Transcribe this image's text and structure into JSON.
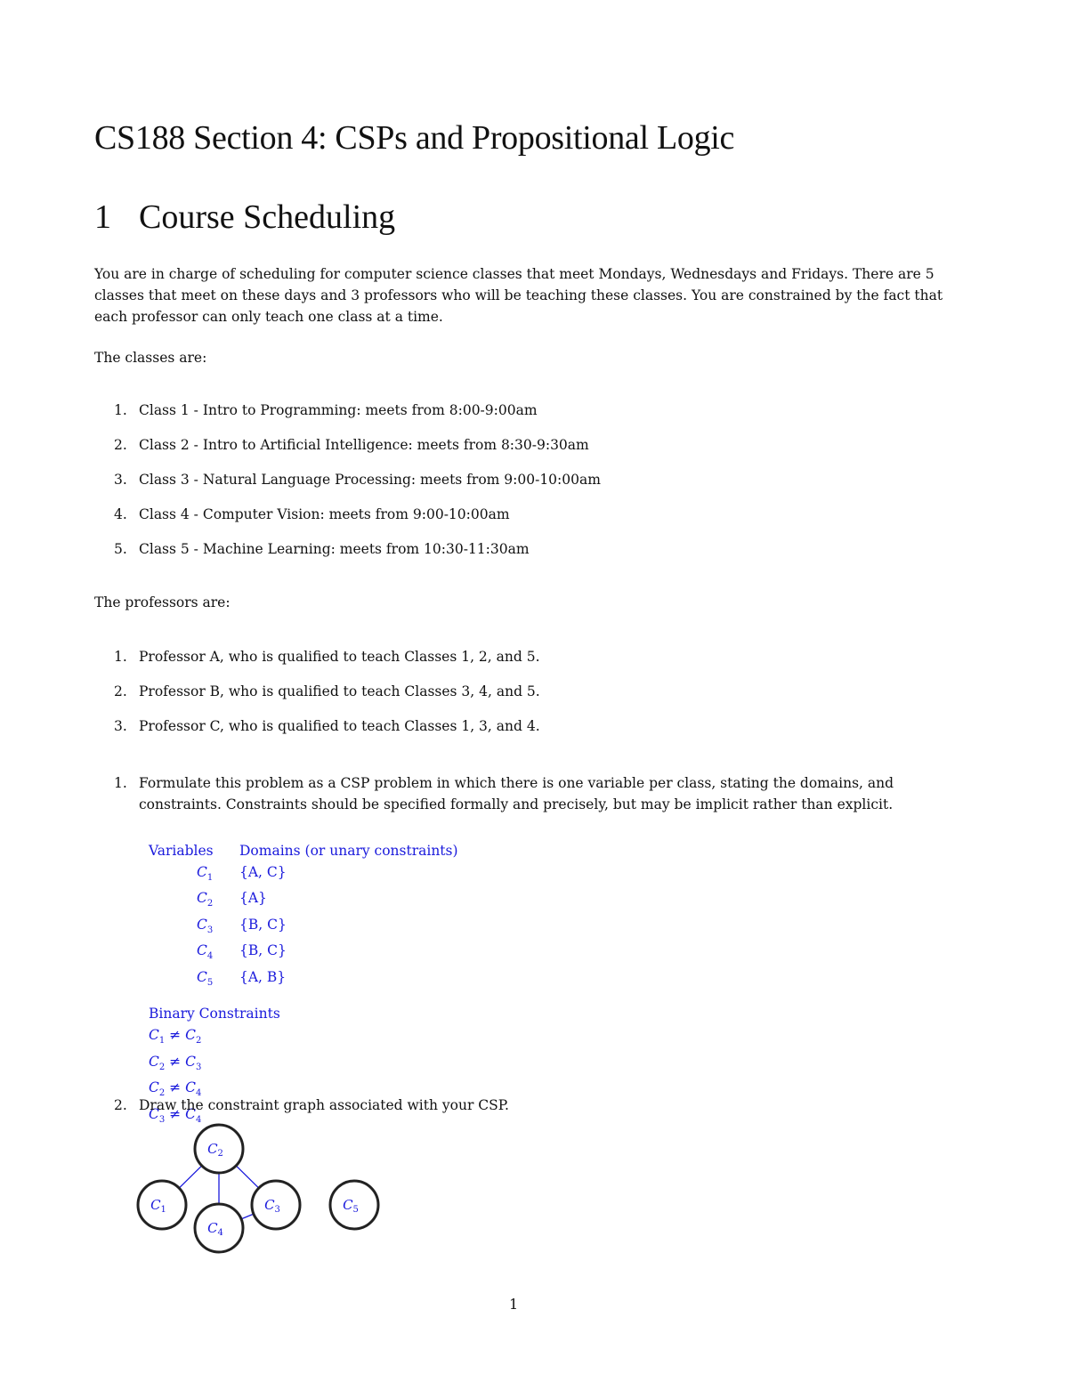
{
  "document": {
    "title": "CS188  Section 4: CSPs and Propositional Logic",
    "section": {
      "number": "1",
      "title": "Course Scheduling"
    },
    "intro": "You are in charge of scheduling for computer science classes that meet Mondays, Wednesdays and Fridays. There are 5 classes that meet on these days and 3 professors who will be teaching these classes. You are constrained by the fact that each professor can only teach one class at a time.",
    "classes_label": "The classes are:",
    "classes": [
      {
        "marker": "1.",
        "text": "Class 1 - Intro to Programming: meets from 8:00-9:00am"
      },
      {
        "marker": "2.",
        "text": "Class 2 - Intro to Artificial Intelligence: meets from 8:30-9:30am"
      },
      {
        "marker": "3.",
        "text": "Class 3 - Natural Language Processing: meets from 9:00-10:00am"
      },
      {
        "marker": "4.",
        "text": "Class 4 - Computer Vision: meets from 9:00-10:00am"
      },
      {
        "marker": "5.",
        "text": "Class 5 - Machine Learning: meets from 10:30-11:30am"
      }
    ],
    "professors_label": "The professors are:",
    "professors": [
      {
        "marker": "1.",
        "text": "Professor A, who is qualified to teach Classes 1, 2, and 5."
      },
      {
        "marker": "2.",
        "text": "Professor B, who is qualified to teach Classes 3, 4, and 5."
      },
      {
        "marker": "3.",
        "text": "Professor C, who is qualified to teach Classes 1, 3, and 4."
      }
    ],
    "questions": [
      {
        "marker": "1.",
        "text": "Formulate this problem as a CSP problem in which there is one variable per class, stating the domains, and constraints. Constraints should be specified formally and precisely, but may be implicit rather than explicit."
      },
      {
        "marker": "2.",
        "text": "Draw the constraint graph associated with your CSP."
      }
    ],
    "solution": {
      "variables_header": "Variables",
      "domains_header": "Domains (or unary constraints)",
      "rows": [
        {
          "var": "C",
          "sub": "1",
          "domain": "{A, C}"
        },
        {
          "var": "C",
          "sub": "2",
          "domain": "{A}"
        },
        {
          "var": "C",
          "sub": "3",
          "domain": "{B, C}"
        },
        {
          "var": "C",
          "sub": "4",
          "domain": "{B, C}"
        },
        {
          "var": "C",
          "sub": "5",
          "domain": "{A, B}"
        }
      ],
      "binary_header": "Binary Constraints",
      "neq_symbol": "≠",
      "binary": [
        {
          "a": "1",
          "b": "2"
        },
        {
          "a": "2",
          "b": "3"
        },
        {
          "a": "2",
          "b": "4"
        },
        {
          "a": "3",
          "b": "4"
        }
      ]
    },
    "graph": {
      "nodes": [
        {
          "id": "C2",
          "label": "C",
          "sub": "2"
        },
        {
          "id": "C1",
          "label": "C",
          "sub": "1"
        },
        {
          "id": "C4",
          "label": "C",
          "sub": "4"
        },
        {
          "id": "C3",
          "label": "C",
          "sub": "3"
        },
        {
          "id": "C5",
          "label": "C",
          "sub": "5"
        }
      ],
      "edges": [
        [
          "C1",
          "C2"
        ],
        [
          "C2",
          "C4"
        ],
        [
          "C2",
          "C3"
        ],
        [
          "C3",
          "C4"
        ]
      ],
      "edge_color": "#1a1adc",
      "node_stroke": "#222222"
    },
    "page_number": "1"
  }
}
